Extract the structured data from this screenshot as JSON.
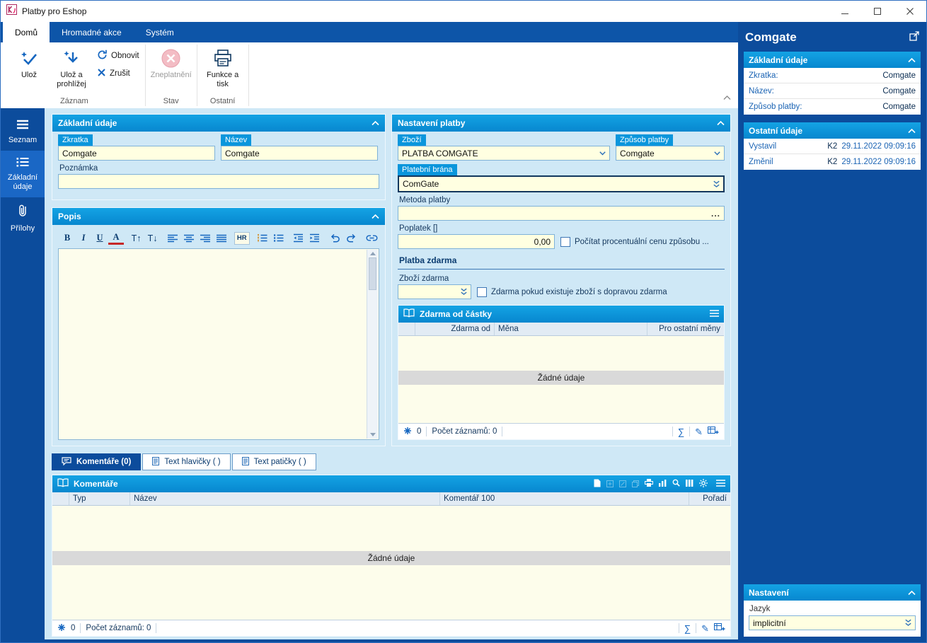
{
  "window": {
    "title": "Platby pro Eshop"
  },
  "colors": {
    "accent_blue": "#0a96dc",
    "dark_blue": "#0c4c9c",
    "field_yellow": "#ffffe1",
    "empty_gray": "#d9d9d9"
  },
  "glyphs": {
    "sigma": "∑",
    "pencil": "✎",
    "dots": "..."
  },
  "ribbon": {
    "tabs": [
      {
        "label": "Domů"
      },
      {
        "label": "Hromadné akce"
      },
      {
        "label": "Systém"
      }
    ],
    "buttons": {
      "save": "Ulož",
      "save_browse": "Ulož a prohlížej",
      "refresh": "Obnovit",
      "cancel": "Zrušit",
      "invalidate": "Zneplatnění",
      "functions_print": "Funkce a tisk"
    },
    "groups": {
      "record": "Záznam",
      "state": "Stav",
      "other": "Ostatní"
    }
  },
  "nav": {
    "items": [
      {
        "label": "Seznam"
      },
      {
        "label": "Základní údaje"
      },
      {
        "label": "Přílohy"
      }
    ]
  },
  "basic": {
    "title": "Základní údaje",
    "zkratka_label": "Zkratka",
    "zkratka_value": "Comgate",
    "nazev_label": "Název",
    "nazev_value": "Comgate",
    "poznamka_label": "Poznámka",
    "poznamka_value": ""
  },
  "popis": {
    "title": "Popis",
    "toolbar": {
      "bold": "B",
      "italic": "I",
      "underline": "U",
      "color": "A",
      "font_bigger": "T↑",
      "font_smaller": "T↓",
      "hr": "HR"
    }
  },
  "payment": {
    "title": "Nastavení platby",
    "zbozi_label": "Zboží",
    "zbozi_value": "PLATBA COMGATE",
    "zpusob_label": "Způsob platby",
    "zpusob_value": "Comgate",
    "brana_label": "Platební brána",
    "brana_value": "ComGate",
    "metoda_label": "Metoda platby",
    "metoda_value": "",
    "poplatek_label": "Poplatek []",
    "poplatek_value": "0,00",
    "poplatek_check": "Počítat procentuální cenu způsobu ...",
    "free_title": "Platba zdarma",
    "zbozi_zdarma_label": "Zboží zdarma",
    "zbozi_zdarma_value": "",
    "zdarma_check": "Zdarma pokud existuje zboží s dopravou zdarma"
  },
  "zdarma_table": {
    "title": "Zdarma od částky",
    "columns": [
      "Zdarma od",
      "Měna",
      "Pro ostatní měny"
    ],
    "empty": "Žádné údaje",
    "count": "0",
    "records": "Počet záznamů: 0"
  },
  "tabs": [
    {
      "label": "Komentáře (0)"
    },
    {
      "label": "Text hlavičky ( )"
    },
    {
      "label": "Text patičky ( )"
    }
  ],
  "comments": {
    "title": "Komentáře",
    "columns": [
      "Typ",
      "Název",
      "Komentář 100",
      "Pořadí"
    ],
    "empty": "Žádné údaje",
    "count": "0",
    "records": "Počet záznamů: 0"
  },
  "preview": {
    "title": "Comgate",
    "basic_title": "Základní údaje",
    "rows": [
      {
        "label": "Zkratka:",
        "value": "Comgate"
      },
      {
        "label": "Název:",
        "value": "Comgate"
      },
      {
        "label": "Způsob platby:",
        "value": "Comgate"
      }
    ],
    "other_title": "Ostatní údaje",
    "audit": [
      {
        "label": "Vystavil",
        "user": "K2",
        "date": "29.11.2022 09:09:16"
      },
      {
        "label": "Změnil",
        "user": "K2",
        "date": "29.11.2022 09:09:16"
      }
    ],
    "settings_title": "Nastavení",
    "jazyk_label": "Jazyk",
    "jazyk_value": "implicitní"
  }
}
